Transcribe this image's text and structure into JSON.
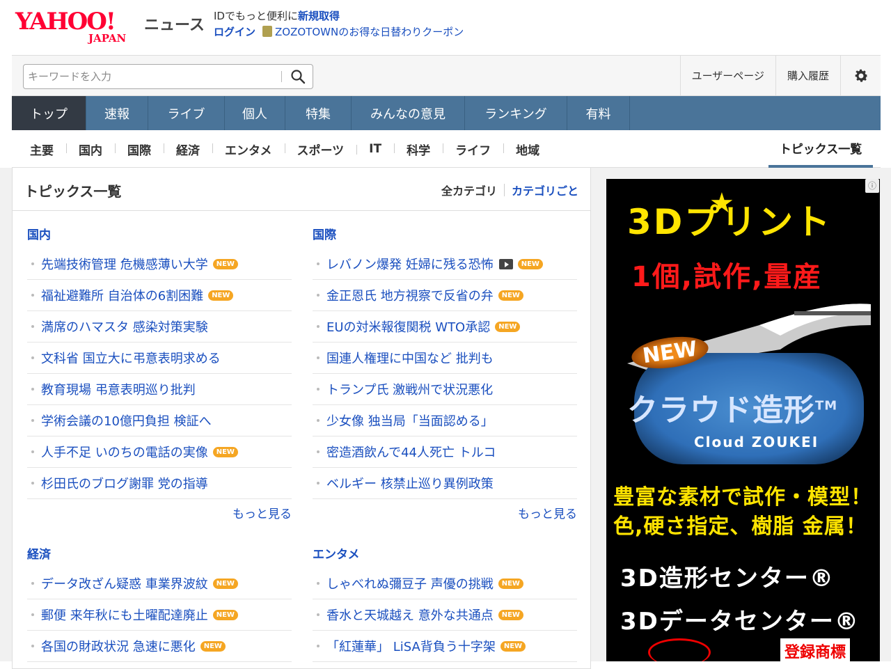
{
  "brand": {
    "logo_text": "YAHOO!",
    "logo_sub": "JAPAN",
    "service_name": "ニュース"
  },
  "header": {
    "promo_prefix": "IDでもっと便利に",
    "signup_label": "新規取得",
    "login_label": "ログイン",
    "coupon_text": "ZOZOTOWNのお得な日替わりクーポン",
    "coupon_icon": "coupon-icon"
  },
  "search": {
    "placeholder": "キーワードを入力",
    "icon": "search-icon",
    "user_page": "ユーザーページ",
    "purchase_history": "購入履歴",
    "settings_icon": "gear-icon"
  },
  "main_nav": [
    "トップ",
    "速報",
    "ライブ",
    "個人",
    "特集",
    "みんなの意見",
    "ランキング",
    "有料"
  ],
  "sub_nav": [
    "主要",
    "国内",
    "国際",
    "経済",
    "エンタメ",
    "スポーツ",
    "IT",
    "科学",
    "ライフ",
    "地域"
  ],
  "sub_nav_active": "トピックス一覧",
  "panel": {
    "title": "トピックス一覧",
    "all_categories": "全カテゴリ",
    "by_category": "カテゴリごと"
  },
  "new_badge": "NEW",
  "more_label": "もっと見る",
  "sections": [
    {
      "category": "国内",
      "items": [
        {
          "text": "先端技術管理 危機感薄い大学",
          "new": true
        },
        {
          "text": "福祉避難所 自治体の6割困難",
          "new": true
        },
        {
          "text": "満席のハマスタ 感染対策実験",
          "new": false
        },
        {
          "text": "文科省 国立大に弔意表明求める",
          "new": false
        },
        {
          "text": "教育現場 弔意表明巡り批判",
          "new": false
        },
        {
          "text": "学術会議の10億円負担 検証へ",
          "new": false
        },
        {
          "text": "人手不足 いのちの電話の実像",
          "new": true
        },
        {
          "text": "杉田氏のブログ謝罪 党の指導",
          "new": false
        }
      ]
    },
    {
      "category": "国際",
      "items": [
        {
          "text": "レバノン爆発 妊婦に残る恐怖",
          "new": true,
          "video": true
        },
        {
          "text": "金正恩氏 地方視察で反省の弁",
          "new": true
        },
        {
          "text": "EUの対米報復関税 WTO承認",
          "new": true
        },
        {
          "text": "国連人権理に中国など 批判も",
          "new": false
        },
        {
          "text": "トランプ氏 激戦州で状況悪化",
          "new": false
        },
        {
          "text": "少女像 独当局「当面認める」",
          "new": false
        },
        {
          "text": "密造酒飲んで44人死亡 トルコ",
          "new": false
        },
        {
          "text": "ベルギー 核禁止巡り異例政策",
          "new": false
        }
      ]
    },
    {
      "category": "経済",
      "items": [
        {
          "text": "データ改ざん疑惑 車業界波紋",
          "new": true
        },
        {
          "text": "郵便 来年秋にも土曜配達廃止",
          "new": true
        },
        {
          "text": "各国の財政状況 急速に悪化",
          "new": true
        }
      ]
    },
    {
      "category": "エンタメ",
      "items": [
        {
          "text": "しゃべれぬ彌豆子 声優の挑戦",
          "new": true
        },
        {
          "text": "香水と天城越え 意外な共通点",
          "new": true
        },
        {
          "text": "「紅蓮華」 LiSA背負う十字架",
          "new": true
        }
      ]
    }
  ],
  "ad": {
    "info_icon": "info-icon",
    "line1": "3Dプリント",
    "line2": "1個,試作,量産",
    "new_tag": "NEW",
    "cloud_title": "クラウド造形",
    "cloud_tm": "TM",
    "cloud_sub": "Cloud ZOUKEI",
    "yellow1": "豊富な素材で試作・模型！",
    "yellow2": "色,硬さ指定、樹脂 金属！",
    "white1": "3D造形センター®",
    "white2": "3Dデータセンター®",
    "registered": "登録商標"
  }
}
